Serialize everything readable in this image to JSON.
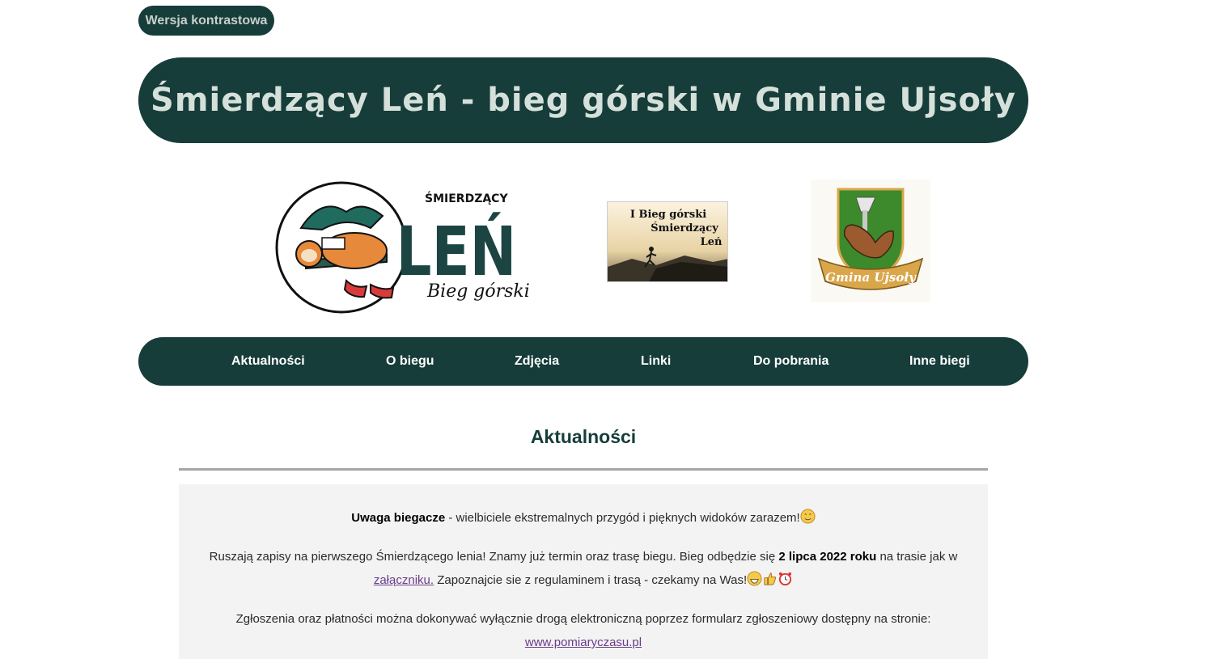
{
  "contrast_button": "Wersja kontrastowa",
  "banner_title": "Śmierdzący Leń - bieg górski w Gminie Ujsoły",
  "logos": {
    "len_small": "ŚMIERDZĄCY",
    "len_big": "LEŃ",
    "len_sub": "Bieg górski",
    "poster_lines": [
      "I Bieg górski",
      "Śmierdzący",
      "Leń"
    ],
    "gmina": "Gmina Ujsoły"
  },
  "nav": [
    "Aktualności",
    "O biegu",
    "Zdjęcia",
    "Linki",
    "Do pobrania",
    "Inne biegi"
  ],
  "section_title": "Aktualności",
  "news": {
    "p1_bold": "Uwaga biegacze",
    "p1_rest": " - wielbiciele ekstremalnych przygód i pięknych widoków zarazem!",
    "p2_a": "Ruszają zapisy na pierwszego Śmierdzącego lenia! Znamy już termin oraz trasę biegu. Bieg odbędzie się ",
    "p2_bold": "2 lipca 2022 roku",
    "p2_b": " na trasie jak w ",
    "p2_link": "załączniku.",
    "p2_c": " Zapoznajcie sie z regulaminem i trasą - czekamy na Was!",
    "p3": "Zgłoszenia oraz płatności można dokonywać wyłącznie drogą elektroniczną poprzez formularz zgłoszeniowy dostępny na stronie:",
    "p3_link": "www.pomiaryczasu.pl"
  },
  "colors": {
    "primary": "#163d3a",
    "banner_text": "#d5e0da",
    "link": "#6a3c8c",
    "news_bg": "#f3f3f3"
  }
}
